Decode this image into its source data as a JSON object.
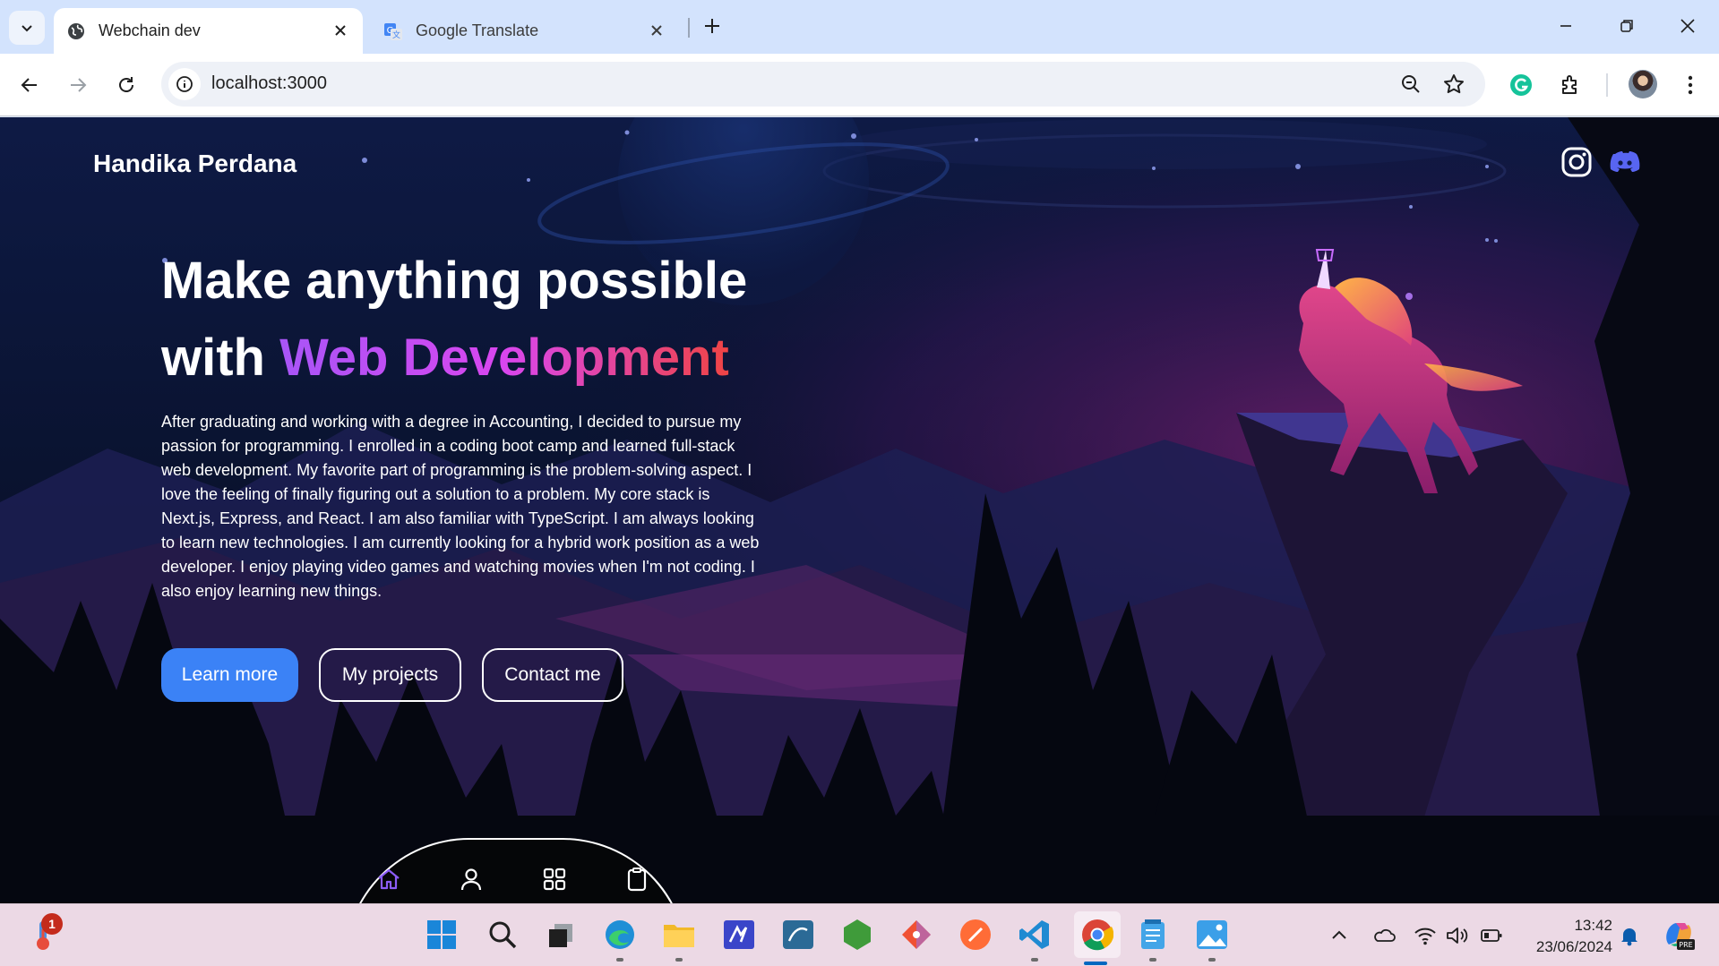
{
  "browser": {
    "tabs": [
      {
        "title": "Webchain dev",
        "active": true
      },
      {
        "title": "Google Translate",
        "active": false
      }
    ],
    "address": "localhost:3000"
  },
  "page": {
    "brand": "Handika Perdana",
    "hero_line1": "Make anything possible",
    "hero_line2_prefix": "with ",
    "hero_highlight": "Web Development",
    "about": "After graduating and working with a degree in Accounting, I decided to pursue my passion for programming. I enrolled in a coding boot camp and learned full-stack web development. My favorite part of programming is the problem-solving aspect. I love the feeling of finally figuring out a solution to a problem. My core stack is Next.js, Express, and React. I am also familiar with TypeScript. I am always looking to learn new technologies. I am currently looking for a hybrid work position as a web developer. I enjoy playing video games and watching movies when I'm not coding. I also enjoy learning new things.",
    "buttons": {
      "learn_more": "Learn more",
      "projects": "My projects",
      "contact": "Contact me"
    },
    "social_icons": [
      "instagram-icon",
      "discord-icon"
    ],
    "bottom_nav_icons": [
      "home-icon",
      "user-icon",
      "grid-icon",
      "clipboard-icon"
    ],
    "accent": "#3b82f6",
    "highlight_gradient": [
      "#a855f7",
      "#d946ef",
      "#ef4444"
    ]
  },
  "taskbar": {
    "notification_count": "1",
    "time": "13:42",
    "date": "23/06/2024"
  }
}
